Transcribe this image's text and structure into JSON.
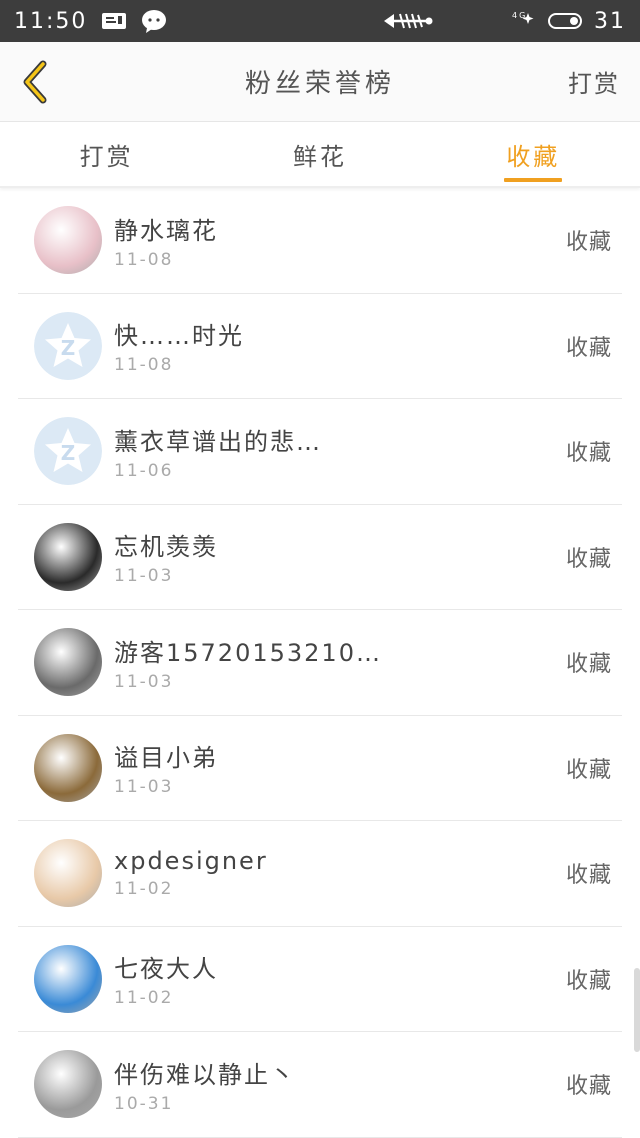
{
  "status_bar": {
    "time": "11:50",
    "battery": "31"
  },
  "nav": {
    "title": "粉丝荣誉榜",
    "action_label": "打赏"
  },
  "tabs": [
    {
      "label": "打赏",
      "active": false
    },
    {
      "label": "鲜花",
      "active": false
    },
    {
      "label": "收藏",
      "active": true
    }
  ],
  "accent_color": "#f0a020",
  "list": [
    {
      "name": "静水璃花",
      "date": "11-08",
      "action": "收藏",
      "avatar": "photo-girl",
      "avatar_color": "#e8c0c8"
    },
    {
      "name": "快……时光",
      "date": "11-08",
      "action": "收藏",
      "avatar": "default-star-avatar",
      "avatar_color": "#dce9f5"
    },
    {
      "name": "薰衣草谱出的悲…",
      "date": "11-06",
      "action": "收藏",
      "avatar": "default-star-avatar",
      "avatar_color": "#dce9f5"
    },
    {
      "name": "忘机羡羡",
      "date": "11-03",
      "action": "收藏",
      "avatar": "photo-dark",
      "avatar_color": "#2a2a2a"
    },
    {
      "name": "游客15720153210…",
      "date": "11-03",
      "action": "收藏",
      "avatar": "photo-grey",
      "avatar_color": "#6a6a6a"
    },
    {
      "name": "谥目小弟",
      "date": "11-03",
      "action": "收藏",
      "avatar": "photo-warrior",
      "avatar_color": "#8b6a3a"
    },
    {
      "name": "xpdesigner",
      "date": "11-02",
      "action": "收藏",
      "avatar": "photo-baby",
      "avatar_color": "#e8c9a8"
    },
    {
      "name": "七夜大人",
      "date": "11-02",
      "action": "收藏",
      "avatar": "photo-blue",
      "avatar_color": "#3a8ad6"
    },
    {
      "name": "伴伤难以静止丶",
      "date": "10-31",
      "action": "收藏",
      "avatar": "photo-bw",
      "avatar_color": "#9a9a9a"
    }
  ]
}
